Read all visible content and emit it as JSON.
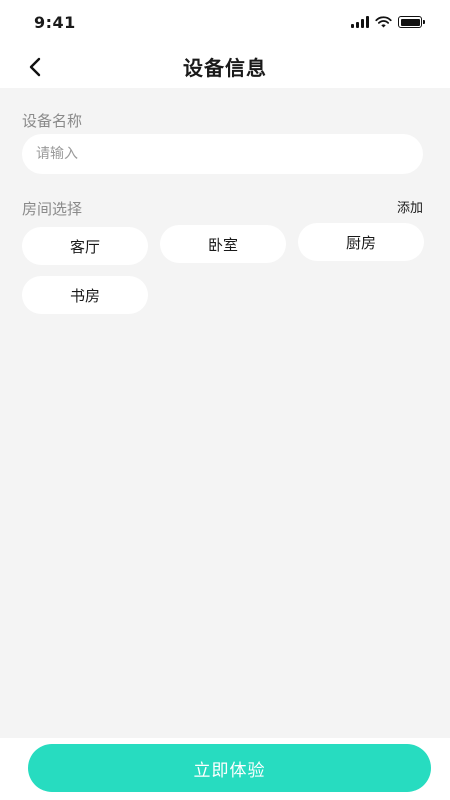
{
  "status_bar": {
    "time": "9:41",
    "icons": [
      "signal-icon",
      "wifi-icon",
      "battery-icon"
    ]
  },
  "nav": {
    "back_icon": "chevron-left-icon",
    "title": "设备信息"
  },
  "form": {
    "name_label": "设备名称",
    "name_placeholder": "请输入",
    "name_value": "",
    "room_label": "房间选择",
    "add_label": "添加",
    "rooms": [
      {
        "label": "客厅"
      },
      {
        "label": "卧室"
      },
      {
        "label": "厨房"
      },
      {
        "label": "书房"
      }
    ]
  },
  "footer": {
    "cta_label": "立即体验"
  },
  "colors": {
    "accent": "#27dcc0",
    "content_bg": "#f4f4f4",
    "label_gray": "#8a8a8a"
  }
}
